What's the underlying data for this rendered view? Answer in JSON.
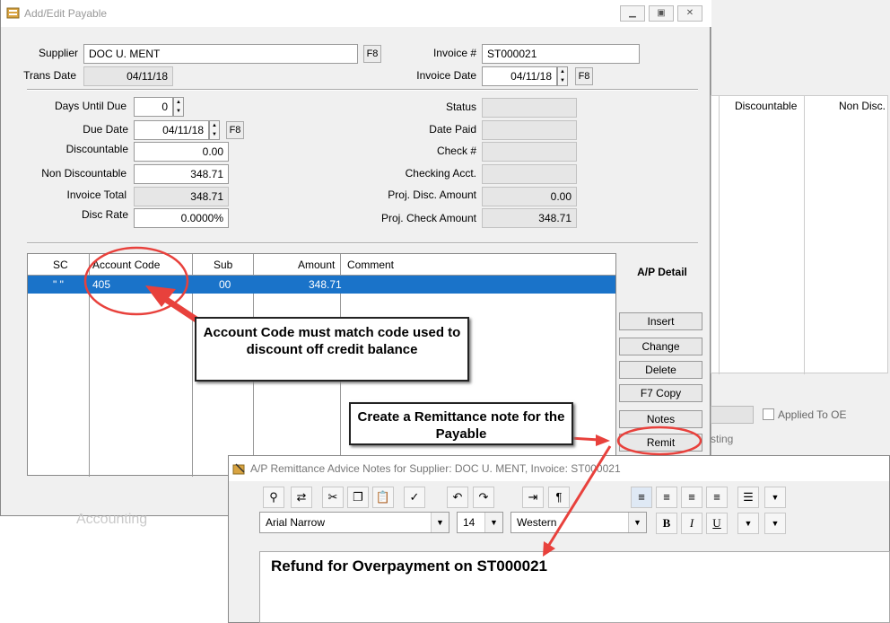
{
  "main_window": {
    "title": "Add/Edit Payable"
  },
  "fields": {
    "supplier_label": "Supplier",
    "supplier": "DOC U. MENT",
    "trans_date_label": "Trans Date",
    "trans_date": "04/11/18",
    "invoice_label": "Invoice #",
    "invoice": "ST000021",
    "invoice_date_label": "Invoice Date",
    "invoice_date": "04/11/18",
    "days_until_due_label": "Days Until Due",
    "days_until_due": "0",
    "due_date_label": "Due Date",
    "due_date": "04/11/18",
    "discountable_label": "Discountable",
    "discountable": "0.00",
    "non_discountable_label": "Non Discountable",
    "non_discountable": "348.71",
    "invoice_total_label": "Invoice Total",
    "invoice_total": "348.71",
    "disc_rate_label": "Disc Rate",
    "disc_rate": "0.0000%",
    "status_label": "Status",
    "date_paid_label": "Date Paid",
    "check_label": "Check #",
    "checking_acct_label": "Checking Acct.",
    "proj_disc_label": "Proj. Disc. Amount",
    "proj_disc": "0.00",
    "proj_check_label": "Proj. Check Amount",
    "proj_check": "348.71",
    "f8": "F8"
  },
  "grid": {
    "headers": [
      "SC",
      "Account Code",
      "Sub",
      "Amount",
      "Comment"
    ],
    "row": {
      "sc": "\" \"",
      "account": "405",
      "sub": "00",
      "amount": "348.71",
      "comment": ""
    }
  },
  "side_panel": {
    "title": "A/P Detail",
    "buttons": [
      "Insert",
      "Change",
      "Delete",
      "F7 Copy",
      "Notes",
      "Remit"
    ]
  },
  "background_window": {
    "col_discountable": "Discountable",
    "col_non_disc": "Non Disc.",
    "applied_to_oe": "Applied To OE",
    "posting_fragment": "sting"
  },
  "remit_window": {
    "title": "A/P Remittance Advice Notes for Supplier: DOC U. MENT, Invoice: ST000021",
    "font": "Arial Narrow",
    "size": "14",
    "script": "Western",
    "bold": "B",
    "italic": "I",
    "underline": "U",
    "note_text": "Refund for Overpayment on ST000021"
  },
  "callouts": {
    "account_code": "Account Code must match code used to discount off credit balance",
    "remittance": "Create a Remittance note for the Payable"
  },
  "logo_text": "Accounting",
  "colors": {
    "selection": "#1a73c9",
    "annotation": "#e8413c"
  }
}
